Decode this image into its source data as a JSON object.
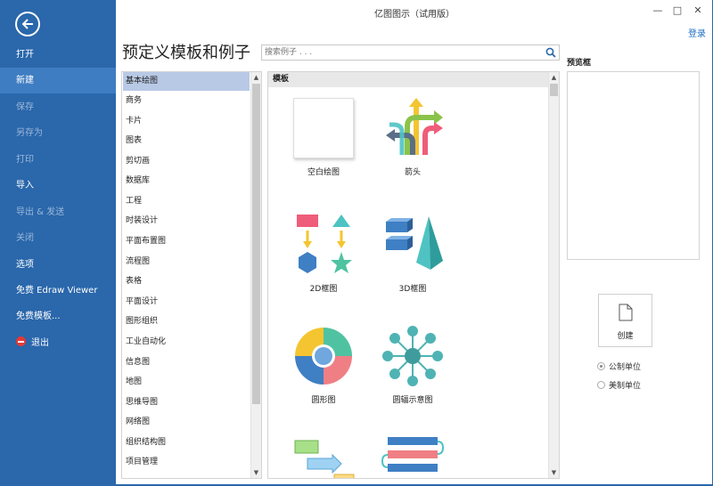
{
  "window": {
    "title": "亿图图示（试用版）",
    "minimize_icon": "minimize-icon",
    "maximize_icon": "maximize-icon",
    "close_icon": "close-icon",
    "login": "登录"
  },
  "sidebar": {
    "back_icon": "back-arrow-icon",
    "items": [
      {
        "label": "打开",
        "state": "normal"
      },
      {
        "label": "新建",
        "state": "active"
      },
      {
        "label": "保存",
        "state": "disabled"
      },
      {
        "label": "另存为",
        "state": "disabled"
      },
      {
        "label": "打印",
        "state": "disabled"
      },
      {
        "label": "导入",
        "state": "normal"
      },
      {
        "label": "导出 & 发送",
        "state": "disabled"
      },
      {
        "label": "关闭",
        "state": "disabled"
      },
      {
        "label": "选项",
        "state": "normal"
      },
      {
        "label": "免费 Edraw Viewer",
        "state": "normal"
      },
      {
        "label": "免费模板...",
        "state": "normal"
      },
      {
        "label": "退出",
        "state": "normal",
        "icon": "exit-icon"
      }
    ]
  },
  "main": {
    "heading": "预定义模板和例子",
    "search": {
      "placeholder": "搜索例子 . . ."
    },
    "categories": [
      "基本绘图",
      "商务",
      "卡片",
      "图表",
      "剪切画",
      "数据库",
      "工程",
      "时装设计",
      "平面布置图",
      "流程图",
      "表格",
      "平面设计",
      "图形组织",
      "工业自动化",
      "信息图",
      "地图",
      "思维导图",
      "网络图",
      "组织结构图",
      "项目管理"
    ],
    "selected_category": "基本绘图",
    "templates_header": "模板",
    "templates": [
      {
        "label": "空白绘图",
        "icon": "blank-drawing-icon"
      },
      {
        "label": "箭头",
        "icon": "arrows-icon"
      },
      {
        "label": "2D框图",
        "icon": "2d-block-icon"
      },
      {
        "label": "3D框图",
        "icon": "3d-block-icon"
      },
      {
        "label": "圆形图",
        "icon": "circle-diagram-icon"
      },
      {
        "label": "圆辐示意图",
        "icon": "radial-diagram-icon"
      }
    ]
  },
  "preview": {
    "label": "预览框",
    "create_label": "创建",
    "units": [
      {
        "label": "公制单位",
        "selected": true
      },
      {
        "label": "美制单位",
        "selected": false
      }
    ]
  },
  "colors": {
    "sidebar": "#2a67ab",
    "sidebar_active": "#3e7dc2",
    "selection": "#b8c9e6",
    "link": "#1f6fc5"
  }
}
